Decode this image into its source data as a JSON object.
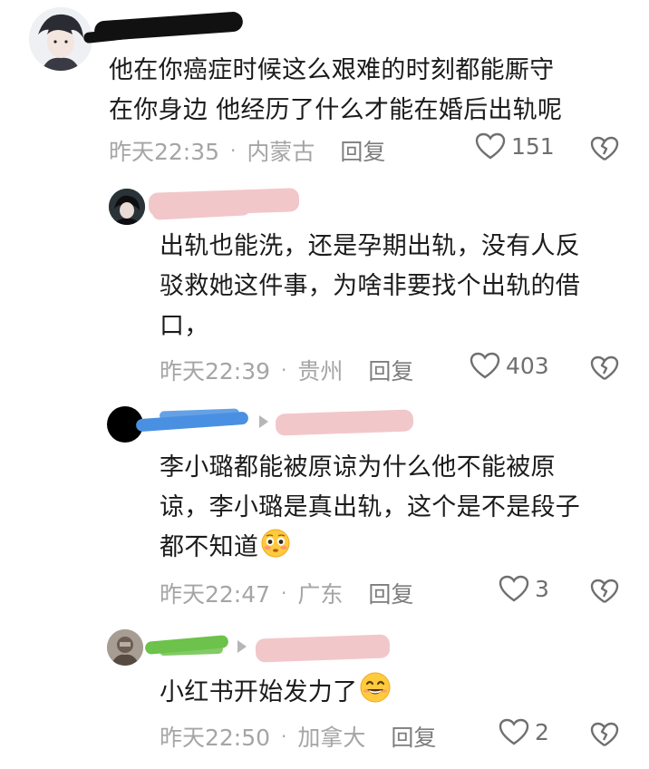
{
  "comments": [
    {
      "text_lines": [
        "他在你癌症时候这么艰难的时刻都能厮守",
        "在你身边 他经历了什么才能在婚后出轨呢"
      ],
      "time": "昨天22:35",
      "location": "内蒙古",
      "reply_label": "回复",
      "likes": "151"
    },
    {
      "text_lines": [
        "出轨也能洗，还是孕期出轨，没有人反",
        "驳救她这件事，为啥非要找个出轨的借",
        "口，"
      ],
      "time": "昨天22:39",
      "location": "贵州",
      "reply_label": "回复",
      "likes": "403"
    },
    {
      "text_lines": [
        "李小璐都能被原谅为什么他不能被原",
        "谅，李小璐是真出轨，这个是不是段子",
        "都不知道"
      ],
      "time": "昨天22:47",
      "location": "广东",
      "reply_label": "回复",
      "likes": "3",
      "emoji": "flushed-face-emoji"
    },
    {
      "text_lines": [
        "小红书开始发力了"
      ],
      "time": "昨天22:50",
      "location": "加拿大",
      "reply_label": "回复",
      "likes": "2",
      "emoji": "smiling-face-emoji"
    }
  ],
  "colors": {
    "redact_black": "#111111",
    "redact_pink": "#f2c7c9",
    "redact_blue": "#4a90e2",
    "redact_green": "#6cc24a",
    "meta_gray": "#a5a5a5",
    "icon_gray": "#6f6f6f"
  },
  "icons": [
    "heart-outline-icon",
    "broken-heart-icon",
    "reply-arrow-icon"
  ]
}
